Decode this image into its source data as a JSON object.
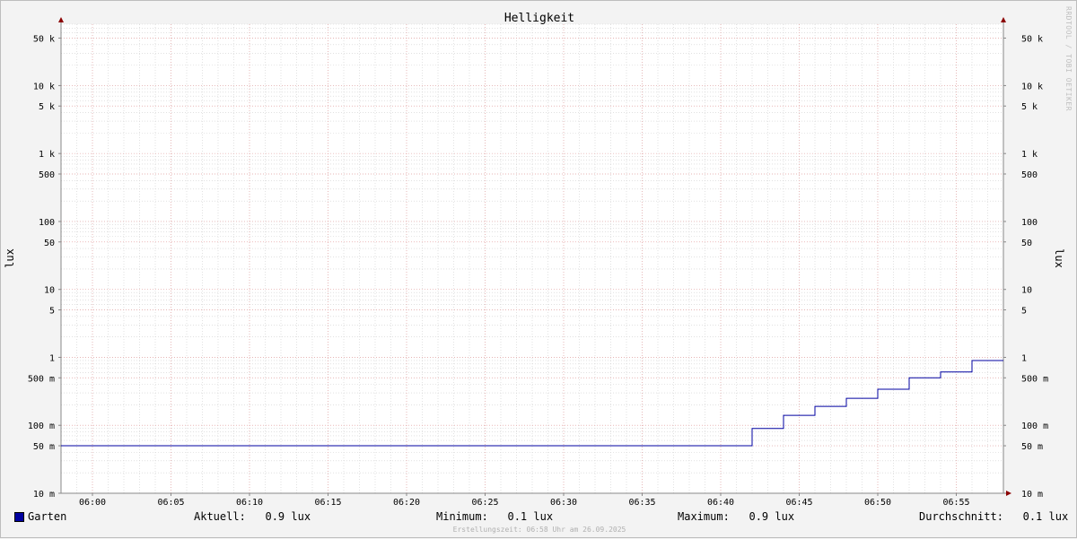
{
  "chart_data": {
    "type": "line",
    "title": "Helligkeit",
    "ylabel": "lux",
    "ylabel_right": "lux",
    "yscale": "log",
    "ylim": [
      10,
      80000
    ],
    "xlim": [
      "05:58",
      "06:58"
    ],
    "x_ticks": [
      "06:00",
      "06:05",
      "06:10",
      "06:15",
      "06:20",
      "06:25",
      "06:30",
      "06:35",
      "06:40",
      "06:45",
      "06:50",
      "06:55"
    ],
    "y_ticks": [
      {
        "value": 50000,
        "label": "50 k"
      },
      {
        "value": 10000,
        "label": "10 k"
      },
      {
        "value": 5000,
        "label": "5 k"
      },
      {
        "value": 1000,
        "label": "1 k"
      },
      {
        "value": 500,
        "label": "500"
      },
      {
        "value": 100,
        "label": "100"
      },
      {
        "value": 50,
        "label": "50"
      },
      {
        "value": 10,
        "label": "10"
      },
      {
        "value": 5,
        "label": "5"
      },
      {
        "value": 1,
        "label": "1"
      },
      {
        "value": 0.5,
        "label": "500 m"
      },
      {
        "value": 0.1,
        "label": "100 m"
      },
      {
        "value": 0.05,
        "label": "50 m"
      },
      {
        "value": 0.01,
        "label": "10 m"
      }
    ],
    "grid": true,
    "series": [
      {
        "name": "Garten",
        "color": "#0000a0",
        "step": true,
        "points": [
          {
            "x": "05:58",
            "y": 0.05
          },
          {
            "x": "06:42",
            "y": 0.09
          },
          {
            "x": "06:44",
            "y": 0.14
          },
          {
            "x": "06:46",
            "y": 0.19
          },
          {
            "x": "06:48",
            "y": 0.25
          },
          {
            "x": "06:50",
            "y": 0.34
          },
          {
            "x": "06:52",
            "y": 0.5
          },
          {
            "x": "06:54",
            "y": 0.61
          },
          {
            "x": "06:56",
            "y": 0.9
          },
          {
            "x": "06:58",
            "y": 0.9
          }
        ]
      }
    ]
  },
  "legend": {
    "series_name": "Garten",
    "aktuell": "Aktuell:   0.9 lux",
    "minimum": "Minimum:   0.1 lux",
    "maximum": "Maximum:   0.9 lux",
    "durchschnitt": "Durchschnitt:   0.1 lux"
  },
  "footer": "Erstellungszeit: 06:58 Uhr am 26.09.2025",
  "watermark": "RRDTOOL / TOBI OETIKER",
  "colors": {
    "line": "#0000a0",
    "major_grid": "#e8a6a6",
    "minor_grid": "#cfcfcf",
    "arrow": "#8b0000"
  }
}
